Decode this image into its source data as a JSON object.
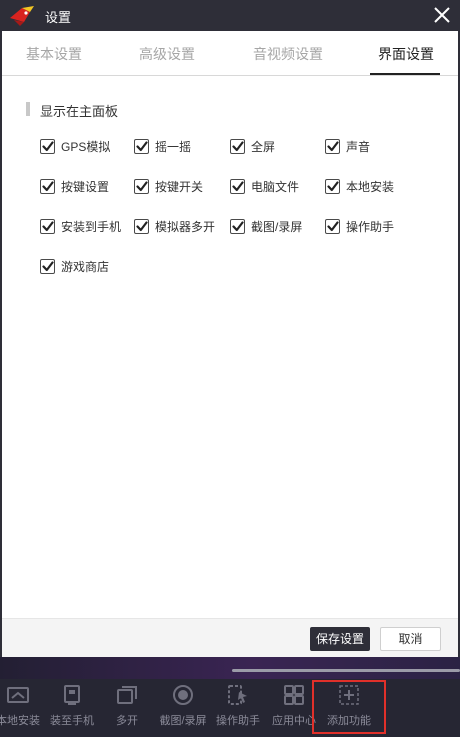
{
  "window": {
    "title": "设置",
    "logo_icon": "app-bird-logo-icon",
    "close_icon": "close-icon"
  },
  "tabs": [
    {
      "label": "基本设置",
      "active": false
    },
    {
      "label": "高级设置",
      "active": false
    },
    {
      "label": "音视频设置",
      "active": false
    },
    {
      "label": "界面设置",
      "active": true
    }
  ],
  "section": {
    "title": "显示在主面板"
  },
  "options": [
    {
      "label": "GPS模拟",
      "checked": true
    },
    {
      "label": "摇一摇",
      "checked": true
    },
    {
      "label": "全屏",
      "checked": true
    },
    {
      "label": "声音",
      "checked": true
    },
    {
      "label": "按键设置",
      "checked": true
    },
    {
      "label": "按键开关",
      "checked": true
    },
    {
      "label": "电脑文件",
      "checked": true
    },
    {
      "label": "本地安装",
      "checked": true
    },
    {
      "label": "安装到手机",
      "checked": true
    },
    {
      "label": "模拟器多开",
      "checked": true
    },
    {
      "label": "截图/录屏",
      "checked": true
    },
    {
      "label": "操作助手",
      "checked": true
    },
    {
      "label": "游戏商店",
      "checked": true
    }
  ],
  "footer": {
    "save_label": "保存设置",
    "cancel_label": "取消"
  },
  "dock": [
    {
      "label": "本地安装",
      "icon": "local-install-icon"
    },
    {
      "label": "装至手机",
      "icon": "install-to-phone-icon"
    },
    {
      "label": "多开",
      "icon": "multi-instance-icon"
    },
    {
      "label": "截图/录屏",
      "icon": "screenshot-record-icon"
    },
    {
      "label": "操作助手",
      "icon": "operation-assistant-icon"
    },
    {
      "label": "应用中心",
      "icon": "app-center-icon"
    },
    {
      "label": "添加功能",
      "icon": "add-feature-icon"
    }
  ],
  "colors": {
    "accent_dark": "#2e2e38",
    "highlight_red": "#e0302a"
  }
}
